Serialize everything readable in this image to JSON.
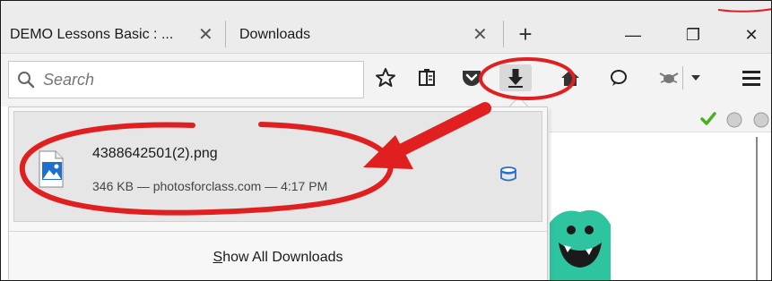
{
  "tabs": [
    {
      "title": "DEMO Lessons Basic : ...",
      "close": "✕"
    },
    {
      "title": "Downloads",
      "close": "✕"
    }
  ],
  "newtab_symbol": "+",
  "window": {
    "minimize": "—",
    "restore": "❐",
    "close": "✕"
  },
  "search": {
    "placeholder": "Search"
  },
  "toolbar_icons": [
    "bookmark-star-icon",
    "reading-list-icon",
    "pocket-icon",
    "downloads-arrow-icon",
    "home-icon",
    "chat-bubble-icon",
    "bug-extension-icon",
    "dropdown-icon",
    "hamburger-menu-icon"
  ],
  "downloads": {
    "item": {
      "filename": "4388642501(2).png",
      "meta": "346 KB — photosforclass.com — 4:17 PM"
    },
    "show_all": {
      "first_letter": "S",
      "rest": "how All Downloads"
    }
  },
  "colors": {
    "annotation_red": "#e02020",
    "checkmark_green": "#4caf1e",
    "monster_teal": "#2ec4a0"
  }
}
